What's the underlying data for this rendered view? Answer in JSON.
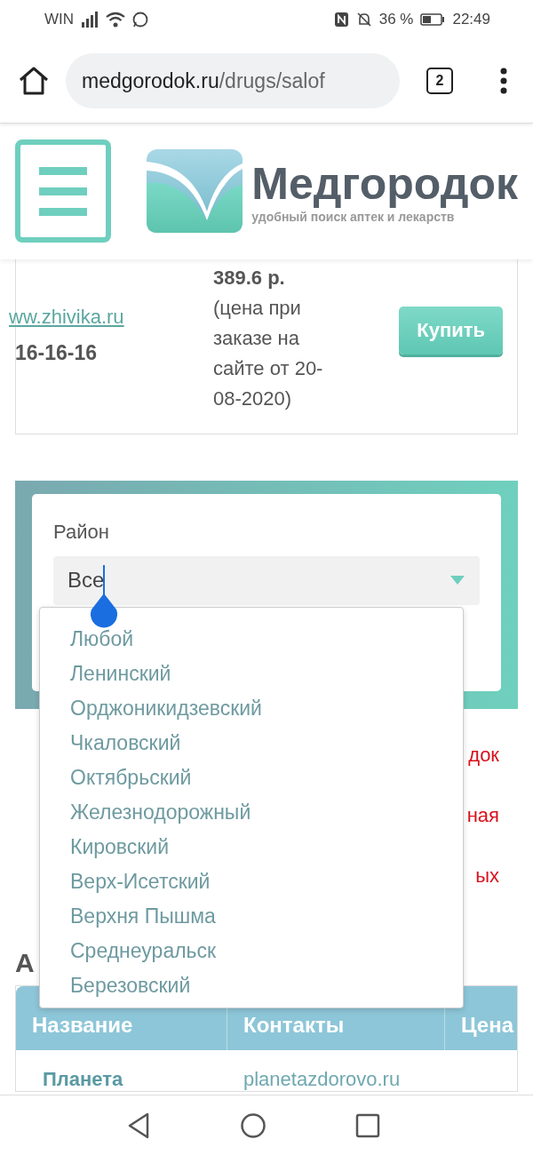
{
  "status_bar": {
    "carrier": "WIN",
    "battery": "36 %",
    "time": "22:49"
  },
  "browser": {
    "url_host": "medgorodok.ru",
    "url_path": "/drugs/salof",
    "tab_count": "2"
  },
  "site_header": {
    "logo_title": "Медгородок",
    "logo_tagline": "удобный поиск аптек и лекарств"
  },
  "offer": {
    "link": "ww.zhivika.ru",
    "phone": "16-16-16",
    "price": "389.6 р.",
    "price_note": "(цена при заказе на сайте от 20-08-2020)",
    "buy_button": "Купить"
  },
  "filter": {
    "label": "Район",
    "value": "Все",
    "options": [
      "Любой",
      "Ленинский",
      "Орджоникидзевский",
      "Чкаловский",
      "Октябрьский",
      "Железнодорожный",
      "Кировский",
      "Верх-Исетский",
      "Верхня Пышма",
      "Среднеуральск",
      "Березовский"
    ]
  },
  "notice_fragments": [
    "док",
    "ная",
    "ых"
  ],
  "section_heading": "А",
  "table": {
    "columns": [
      "Название",
      "Контакты",
      "Цена"
    ],
    "rows": [
      [
        "Планета",
        "planetazdorovo.ru"
      ]
    ]
  }
}
